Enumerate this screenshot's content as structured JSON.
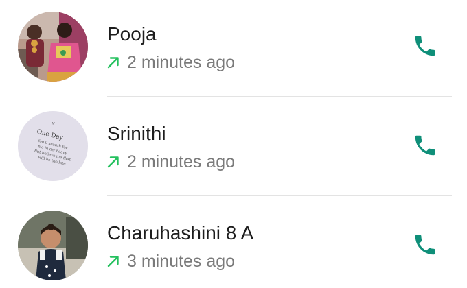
{
  "theme": {
    "accent": "#0f8f79",
    "outgoing_arrow": "#25c15f",
    "name_color": "#1d1d1d",
    "meta_color": "#7a7a7a",
    "divider": "#e3e3e3"
  },
  "calls": [
    {
      "name": "Pooja",
      "time": "2 minutes ago",
      "direction_icon": "outgoing-arrow-icon",
      "action_icon": "phone-icon"
    },
    {
      "name": "Srinithi",
      "time": "2 minutes ago",
      "direction_icon": "outgoing-arrow-icon",
      "action_icon": "phone-icon",
      "avatar_text": {
        "line1": "One Day",
        "line2": "You'll search for",
        "line3": "me in my heavy",
        "line4": "But believe me that",
        "line5": "will be too late."
      }
    },
    {
      "name": "Charuhashini 8 A",
      "time": "3 minutes ago",
      "direction_icon": "outgoing-arrow-icon",
      "action_icon": "phone-icon"
    }
  ]
}
